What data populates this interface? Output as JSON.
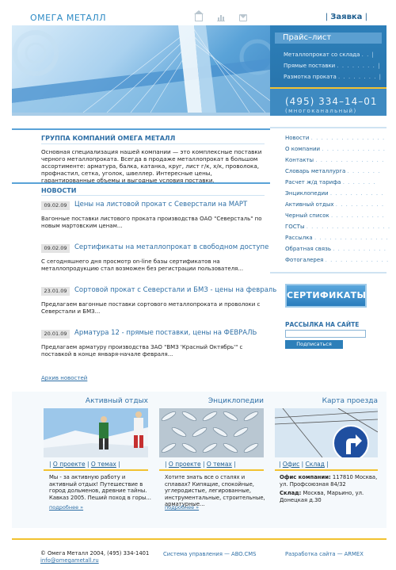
{
  "header": {
    "logo": "ОМЕГА МЕТАЛЛ",
    "request_link": "Заявка"
  },
  "price_list": {
    "title": "Прайс–лист",
    "items": [
      "Металлопрокат со склада",
      "Прямые поставки",
      "Размотка проката"
    ]
  },
  "phone": {
    "number": "(495) 334–14–01",
    "caption": "(многоканальный)"
  },
  "about": {
    "heading": "ГРУППА КОМПАНИЙ ОМЕГА МЕТАЛЛ",
    "text": "Основная специализация нашей компании — это комплексные поставки черного металлопроката. Всегда в продаже металлопрокат в большом ассортименте: арматура, балка, катанка, круг, лист г/к, х/к, проволока, профнастил, сетка, уголок, швеллер. Интересные цены, гарантированные объемы и выгодные условия поставки."
  },
  "news": {
    "heading": "НОВОСТИ",
    "items": [
      {
        "date": "09.02.09",
        "title": "Цены на листовой прокат с Северстали на МАРТ",
        "text": "Вагонные поставки листового проката производства ОАО \"Северсталь\" по новым мартовским ценам..."
      },
      {
        "date": "09.02.09",
        "title": "Сертификаты на металлопрокат в свободном доступе",
        "text": "С сегодняшнего дня просмотр on-line базы сертификатов на металлопродукцию стал возможен без регистрации пользователя..."
      },
      {
        "date": "23.01.09",
        "title": "Сортовой прокат с Северстали и БМЗ - цены на февраль",
        "text": "Предлагаем вагонные поставки сортового металлопроката и проволоки с Северстали и БМЗ..."
      },
      {
        "date": "20.01.09",
        "title": "Арматура 12 - прямые поставки, цены на ФЕВРАЛЬ",
        "text": "Предлагаем арматуру производства ЗАО \"ВМЗ 'Красный Октябрь'\" с поставкой в конце января-начале февраля..."
      }
    ],
    "archive": "Архив новостей"
  },
  "menu": {
    "items": [
      "Новости",
      "О компании",
      "Контакты",
      "Словарь металлурга",
      "Расчет ж/д тарифа",
      "Энциклопедии",
      "Активный отдых",
      "Черный список",
      "ГОСТы",
      "Рассылка",
      "Обратная связь",
      "Фотогалерея"
    ]
  },
  "certificates_button": "СЕРТИФИКАТЫ",
  "mailing": {
    "label": "РАССЫЛКА НА САЙТЕ",
    "input_value": "",
    "button": "Подписаться"
  },
  "blocks": {
    "active": {
      "title": "Активный отдых",
      "tab1": "О проекте",
      "tab2": "О темах",
      "text": "Мы - за активную работу и активный отдых! Путешествие в город дольменов, древние тайны. Кавказ 2005. Пеший поход в горы...",
      "more": "подробнее »"
    },
    "encyclopedia": {
      "title": "Энциклопедии",
      "tab1": "О проекте",
      "tab2": "О темах",
      "text": "Хотите знать все о сталях и сплавах? Кипящие, спокойные, углеродистые, легированные, инструментальные, строительные, арматурные...",
      "more": "подробнее »"
    },
    "map": {
      "title": "Карта проезда",
      "tab1": "Офис",
      "tab2": "Склад",
      "office_label": "Офис компании:",
      "office_text": "117810 Москва, ул. Профсоюзная 84/32",
      "warehouse_label": "Склад:",
      "warehouse_text": "Москва, Марьино, ул. Донецкая д.30"
    }
  },
  "footer": {
    "copyright": "© Омега Металл 2004, (495) 334-1401",
    "email": "info@omegametall.ru",
    "cms": "Система управления — ABO.CMS",
    "dev": "Разработка сайта — ARMEX"
  }
}
